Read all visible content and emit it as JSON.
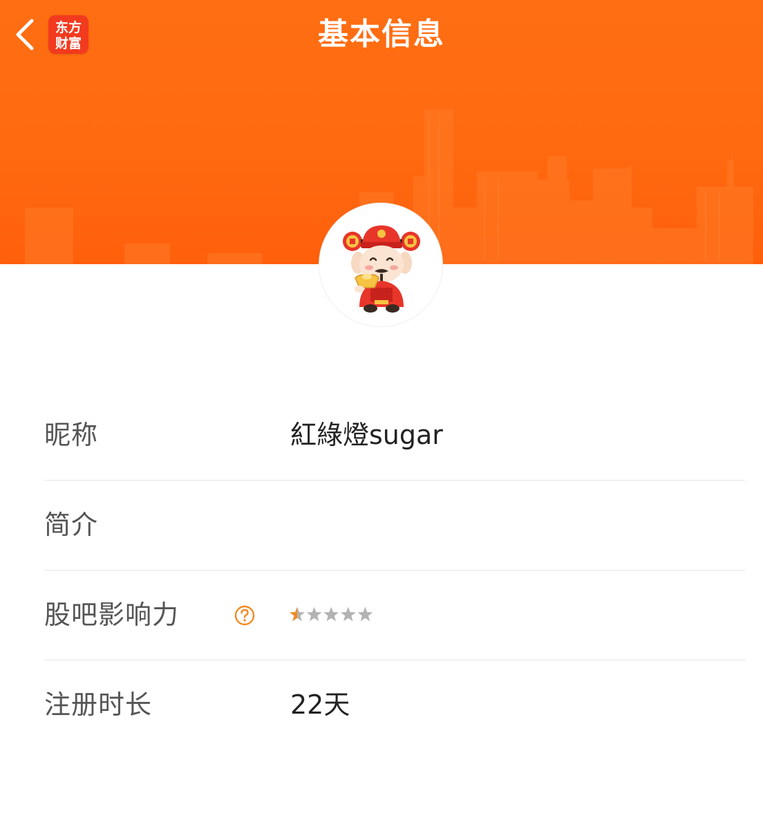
{
  "header": {
    "title": "基本信息",
    "logo_text": "东方财富",
    "colors": {
      "banner": "#ff6a10",
      "logo": "#f23a1e"
    }
  },
  "info": {
    "nickname_label": "昵称",
    "nickname_value": "紅綠燈sugar",
    "bio_label": "简介",
    "bio_value": "",
    "influence_label": "股吧影响力",
    "influence_rating": 0.5,
    "influence_max": 5,
    "registration_label": "注册时长",
    "registration_value": "22天"
  },
  "icons": {
    "back": "chevron-left-icon",
    "help": "question-circle-icon",
    "star": "star-icon",
    "avatar": "god-of-wealth-avatar"
  },
  "colors": {
    "accent": "#f08a24",
    "star_active": "#f08a24",
    "star_inactive": "#b3b3b3"
  }
}
